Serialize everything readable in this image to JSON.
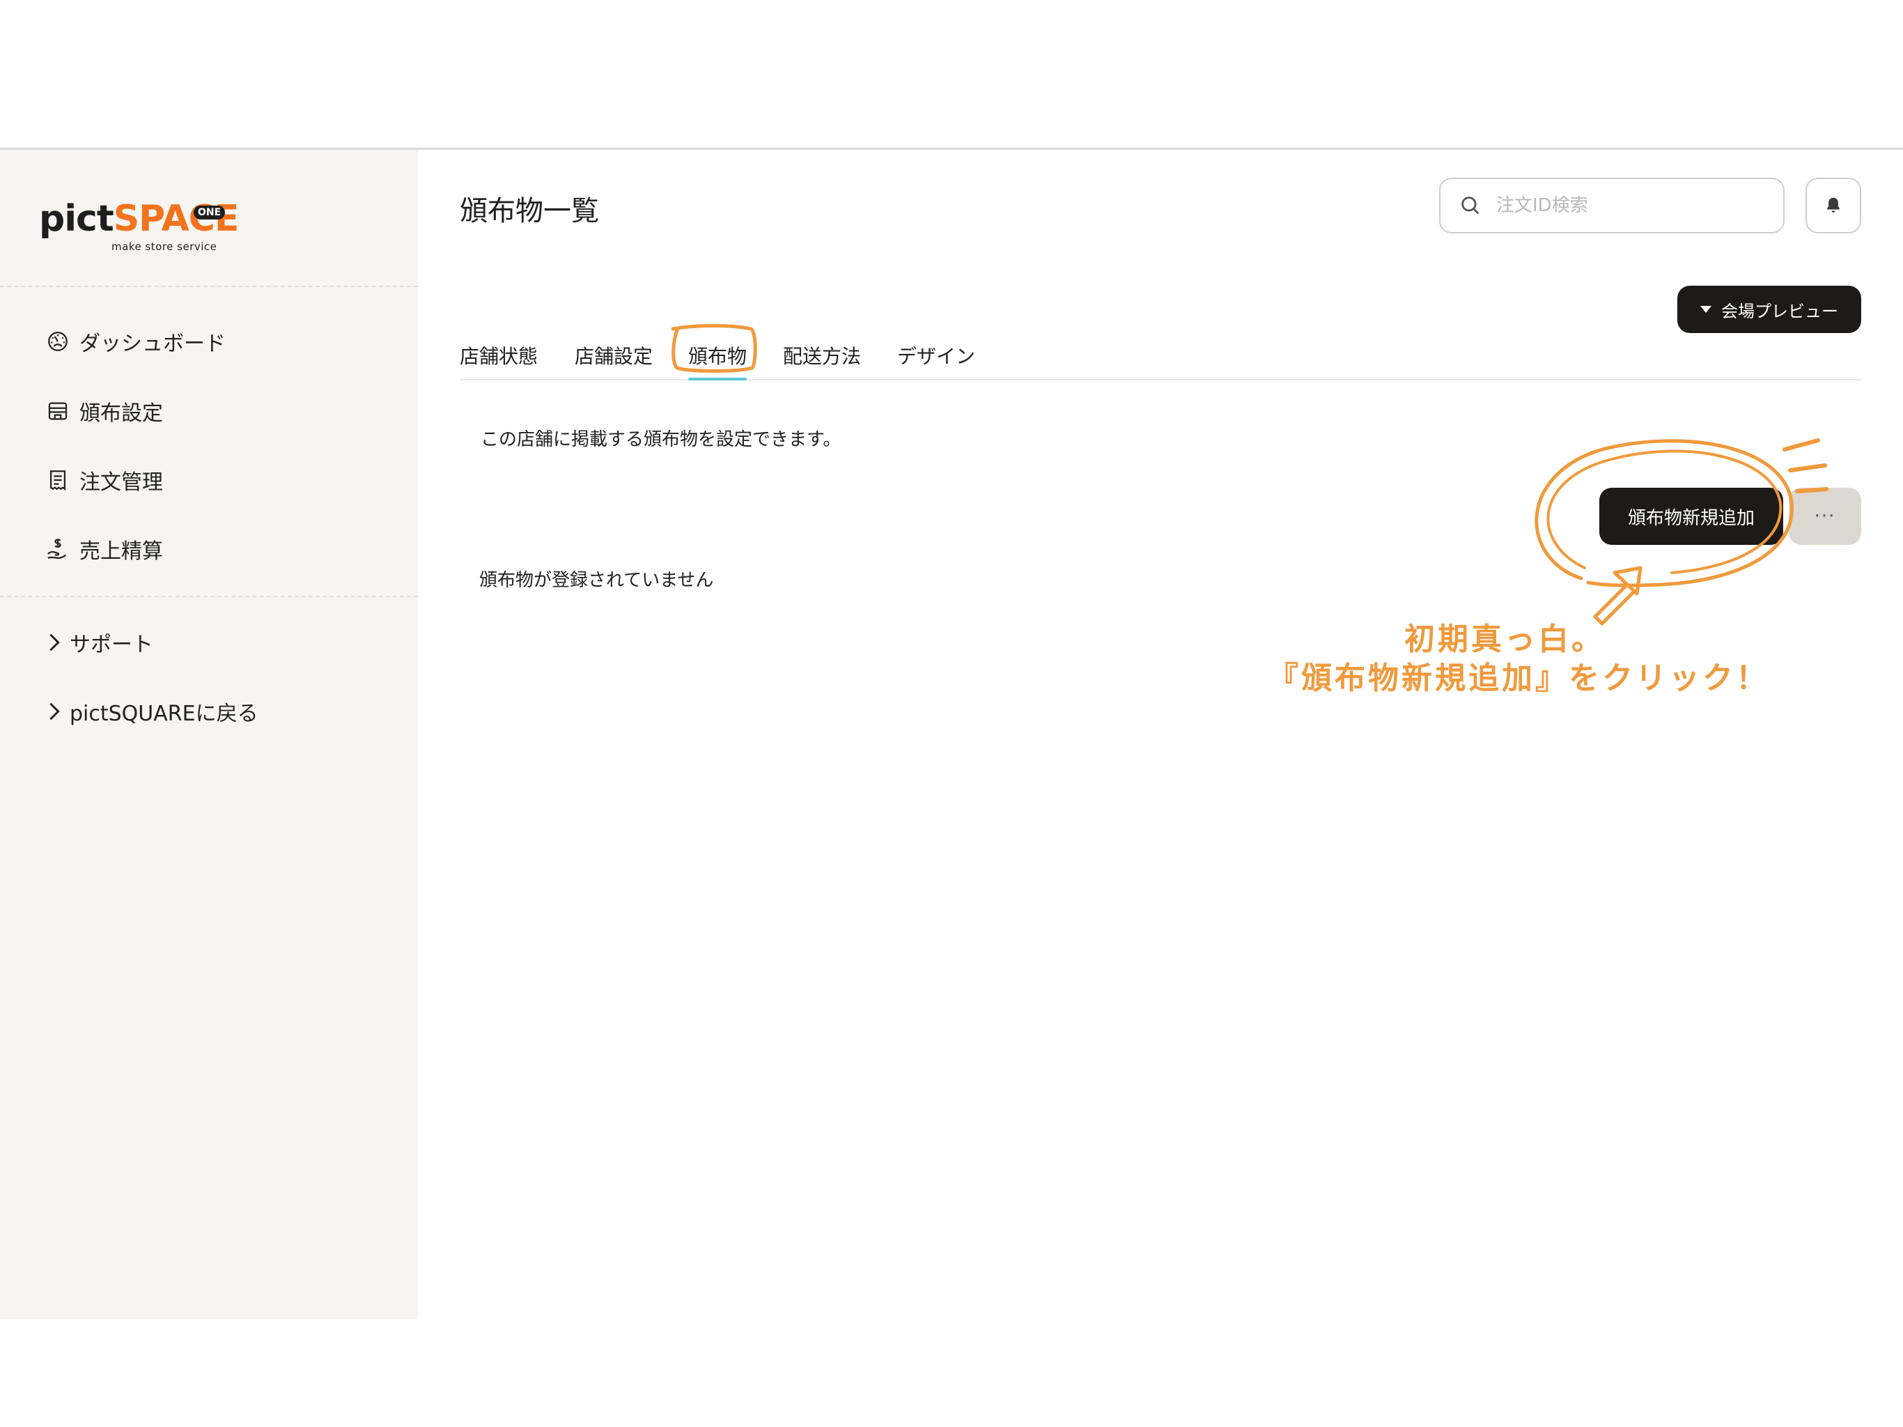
{
  "logo": {
    "part1": "pict",
    "part2": "SPACE",
    "badge": "ONE",
    "tagline": "make store service"
  },
  "sidebar": {
    "items": [
      {
        "label": "ダッシュボード",
        "icon": "dashboard-gauge-icon"
      },
      {
        "label": "頒布設定",
        "icon": "store-icon"
      },
      {
        "label": "注文管理",
        "icon": "receipt-icon"
      },
      {
        "label": "売上精算",
        "icon": "money-hand-icon"
      }
    ],
    "links": [
      {
        "label": "サポート",
        "icon": "chevron-right-icon"
      },
      {
        "label": "pictSQUAREに戻る",
        "icon": "chevron-right-icon"
      }
    ]
  },
  "header": {
    "title": "頒布物一覧",
    "search_placeholder": "注文ID検索"
  },
  "preview_button": "会場プレビュー",
  "tabs": [
    {
      "label": "店舗状態",
      "active": false
    },
    {
      "label": "店舗設定",
      "active": false
    },
    {
      "label": "頒布物",
      "active": true
    },
    {
      "label": "配送方法",
      "active": false
    },
    {
      "label": "デザイン",
      "active": false
    }
  ],
  "content": {
    "description": "この店舗に掲載する頒布物を設定できます。",
    "add_button": "頒布物新規追加",
    "more_button": "···",
    "empty_message": "頒布物が登録されていません"
  },
  "annotation": {
    "line1": "初期真っ白。",
    "line2": "『頒布物新規追加』をクリック！"
  },
  "colors": {
    "brand_orange": "#f2731c",
    "annotation_orange": "#f09a3c",
    "tab_active_cyan": "#58c6d6",
    "dark_button": "#1c1b19",
    "sidebar_bg": "#f6f5f2",
    "more_button_bg": "#dcd8cf"
  }
}
